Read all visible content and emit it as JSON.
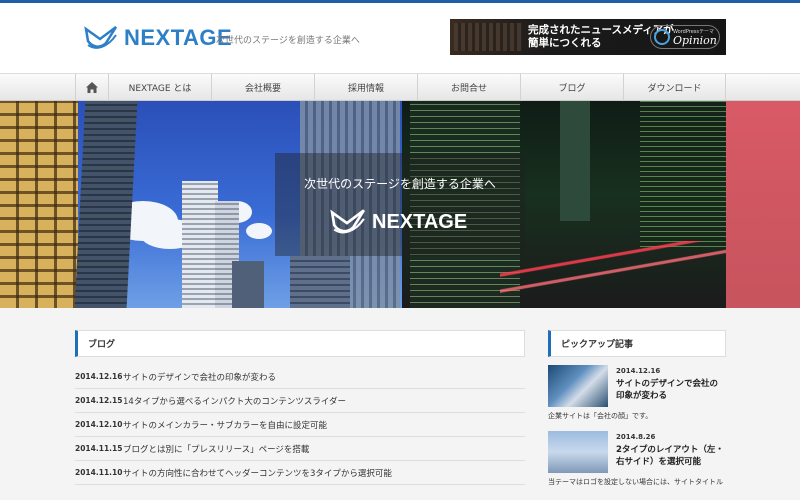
{
  "header": {
    "logo_text": "NEXTAGE",
    "tagline": "次世代のステージを創造する企業へ",
    "banner": {
      "line1": "完成されたニュースメディアが",
      "line2": "簡単につくれる",
      "badge_small": "WordPressテーマ",
      "badge_big": "Opinion"
    }
  },
  "nav": {
    "home_icon": "home-icon",
    "items": [
      "NEXTAGE とは",
      "会社概要",
      "採用情報",
      "お問合せ",
      "ブログ",
      "ダウンロード"
    ]
  },
  "hero": {
    "tagline": "次世代のステージを創造する企業へ",
    "logo_text": "NEXTAGE"
  },
  "blog": {
    "heading": "ブログ",
    "posts": [
      {
        "date": "2014.12.16",
        "title": "サイトのデザインで会社の印象が変わる"
      },
      {
        "date": "2014.12.15",
        "title": "14タイプから選べるインパクト大のコンテンツスライダー"
      },
      {
        "date": "2014.12.10",
        "title": "サイトのメインカラー・サブカラーを自由に設定可能"
      },
      {
        "date": "2014.11.15",
        "title": "ブログとは別に「プレスリリース」ページを搭載"
      },
      {
        "date": "2014.11.10",
        "title": "サイトの方向性に合わせてヘッダーコンテンツを3タイプから選択可能"
      }
    ]
  },
  "pickup": {
    "heading": "ピックアップ記事",
    "items": [
      {
        "date": "2014.12.16",
        "title": "サイトのデザインで会社の印象が変わる",
        "desc": "企業サイトは「会社の顔」です。"
      },
      {
        "date": "2014.8.26",
        "title": "2タイプのレイアウト（左・右サイド）を選択可能",
        "desc": "当テーマはロゴを設定しない場合には、サイトタイトル"
      }
    ]
  },
  "colors": {
    "accent": "#1f6fb8",
    "logo": "#2d7fc8"
  }
}
